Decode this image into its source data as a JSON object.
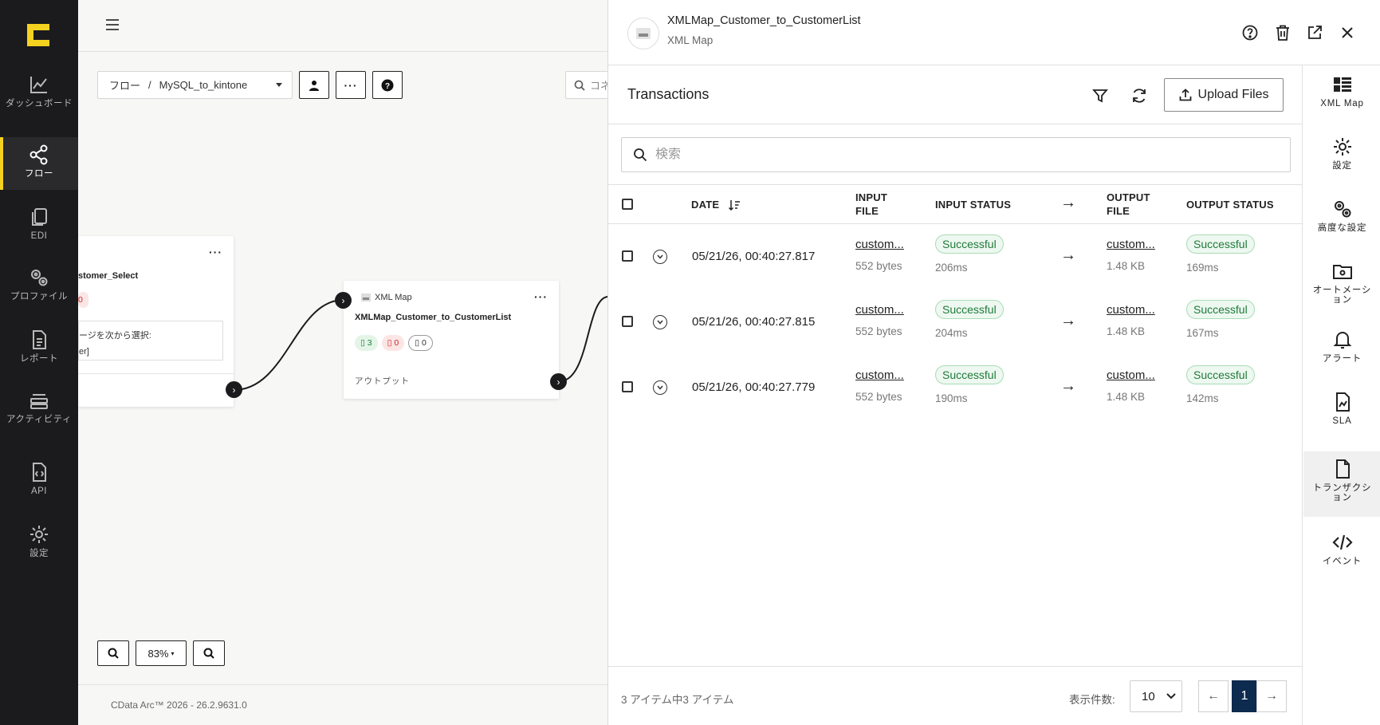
{
  "nav": {
    "items": [
      {
        "label": "ダッシュボード",
        "icon": "chart-line-icon"
      },
      {
        "label": "フロー",
        "icon": "share-nodes-icon"
      },
      {
        "label": "EDI",
        "icon": "copy-icon"
      },
      {
        "label": "プロファイル",
        "icon": "gears-icon"
      },
      {
        "label": "レポート",
        "icon": "file-text-icon"
      },
      {
        "label": "アクティビティ",
        "icon": "layers-icon"
      },
      {
        "label": "API",
        "icon": "file-code-icon"
      },
      {
        "label": "設定",
        "icon": "gear-icon"
      }
    ]
  },
  "canvas": {
    "breadcrumb_root": "フロー",
    "breadcrumb_sep": "/",
    "breadcrumb_flow": "MySQL_to_kintone",
    "search_placeholder": "コネ",
    "node1": {
      "title": "stomer_Select",
      "badge": "0",
      "body_line1": "ージを次から選択:",
      "body_line2": "er]"
    },
    "node2": {
      "type": "XML Map",
      "title": "XMLMap_Customer_to_CustomerList",
      "badge_success": "3",
      "badge_error": "0",
      "badge_pending": "0",
      "output_label": "アウトプット"
    },
    "zoom": "83%",
    "footer": "CData Arc™ 2026 - 26.2.9631.0"
  },
  "panel": {
    "title": "XMLMap_Customer_to_CustomerList",
    "subtitle": "XML Map",
    "transactions_title": "Transactions",
    "upload_label": "Upload Files",
    "search_placeholder": "検索",
    "columns": {
      "date": "DATE",
      "input_file": "INPUT FILE",
      "input_status": "INPUT STATUS",
      "output_file": "OUTPUT FILE",
      "output_status": "OUTPUT STATUS"
    },
    "rows": [
      {
        "date": "05/21/26, 00:40:27.817",
        "input_file": "custom...",
        "input_size": "552 bytes",
        "input_status": "Successful",
        "input_time": "206ms",
        "output_file": "custom...",
        "output_size": "1.48 KB",
        "output_status": "Successful",
        "output_time": "169ms"
      },
      {
        "date": "05/21/26, 00:40:27.815",
        "input_file": "custom...",
        "input_size": "552 bytes",
        "input_status": "Successful",
        "input_time": "204ms",
        "output_file": "custom...",
        "output_size": "1.48 KB",
        "output_status": "Successful",
        "output_time": "167ms"
      },
      {
        "date": "05/21/26, 00:40:27.779",
        "input_file": "custom...",
        "input_size": "552 bytes",
        "input_status": "Successful",
        "input_time": "190ms",
        "output_file": "custom...",
        "output_size": "1.48 KB",
        "output_status": "Successful",
        "output_time": "142ms"
      }
    ],
    "count_text": "3 アイテム中3 アイテム",
    "per_page_label": "表示件数:",
    "per_page_value": "10",
    "current_page": "1"
  },
  "rightbar": {
    "items": [
      {
        "label": "XML Map"
      },
      {
        "label": "設定"
      },
      {
        "label": "高度な設定"
      },
      {
        "label": "オートメーション"
      },
      {
        "label": "アラート"
      },
      {
        "label": "SLA"
      },
      {
        "label": "トランザクション"
      },
      {
        "label": "イベント"
      }
    ]
  },
  "colors": {
    "nav_bg": "#1b1b1d",
    "accent_yellow": "#f4d21f",
    "success_green": "#1f7a3a",
    "pager_active": "#0d2a4f"
  }
}
